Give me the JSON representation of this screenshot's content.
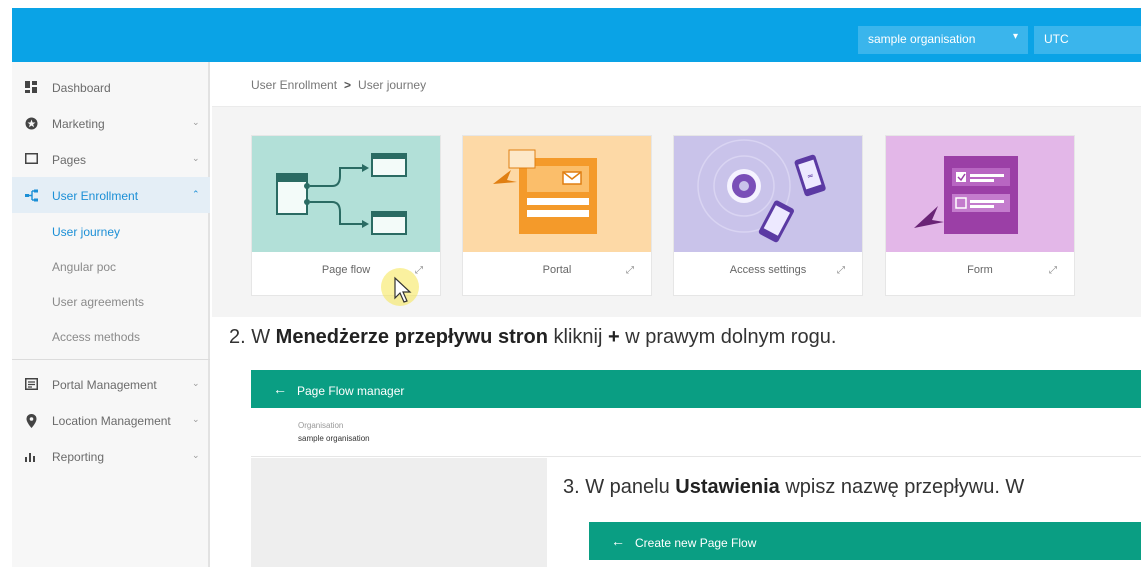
{
  "header": {
    "organisation": "sample organisation",
    "timezone": "UTC",
    "accent": "#0aa3e6"
  },
  "sidebar": {
    "items": [
      {
        "label": "Dashboard",
        "icon": "dashboard-icon"
      },
      {
        "label": "Marketing",
        "icon": "marketing-icon"
      },
      {
        "label": "Pages",
        "icon": "pages-icon"
      },
      {
        "label": "User Enrollment",
        "icon": "user-enrollment-icon",
        "active": true
      },
      {
        "label": "Portal Management",
        "icon": "portal-management-icon"
      },
      {
        "label": "Location Management",
        "icon": "location-pin-icon"
      },
      {
        "label": "Reporting",
        "icon": "reporting-icon"
      }
    ],
    "subitems": [
      {
        "label": "User journey",
        "active": true
      },
      {
        "label": "Angular poc"
      },
      {
        "label": "User agreements"
      },
      {
        "label": "Access methods"
      }
    ]
  },
  "breadcrumb": {
    "parent": "User Enrollment",
    "separator": ">",
    "current": "User journey"
  },
  "cards": [
    {
      "label": "Page flow",
      "color": "#b2e0d8"
    },
    {
      "label": "Portal",
      "color": "#fdd9a6"
    },
    {
      "label": "Access settings",
      "color": "#c9c3ea"
    },
    {
      "label": "Form",
      "color": "#e3b7e8"
    }
  ],
  "instructions": {
    "step2": {
      "prefix": "2. W ",
      "bold": "Menedżerze przepływu stron",
      "middle": " kliknij ",
      "bold2": "+",
      "suffix": " w prawym dolnym rogu."
    },
    "step3": {
      "prefix": "3. W panelu ",
      "bold": "Ustawienia",
      "suffix": " wpisz nazwę przepływu. W"
    }
  },
  "page_flow_manager": {
    "title": "Page Flow manager",
    "org_label": "Organisation",
    "org_value": "sample organisation"
  },
  "create_flow": {
    "title": "Create new Page Flow"
  }
}
